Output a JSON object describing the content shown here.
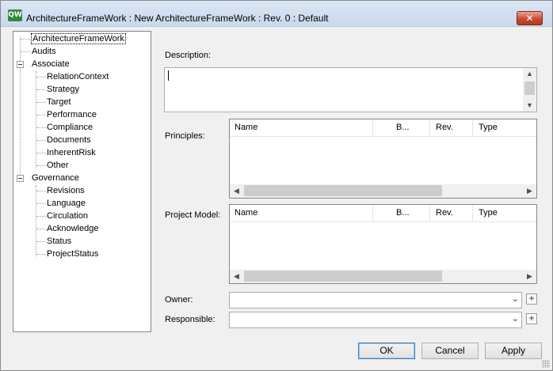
{
  "window": {
    "app_icon": "QW",
    "title": "ArchitectureFrameWork : New ArchitectureFrameWork : Rev. 0  : Default",
    "close_glyph": "✕"
  },
  "tree": {
    "items": [
      {
        "label": "ArchitectureFrameWork",
        "selected": true
      },
      {
        "label": "Audits"
      },
      {
        "label": "Associate",
        "expanded": true
      },
      {
        "label": "RelationContext"
      },
      {
        "label": "Strategy"
      },
      {
        "label": "Target"
      },
      {
        "label": "Performance"
      },
      {
        "label": "Compliance"
      },
      {
        "label": "Documents"
      },
      {
        "label": "InherentRisk"
      },
      {
        "label": "Other"
      },
      {
        "label": "Governance",
        "expanded": true
      },
      {
        "label": "Revisions"
      },
      {
        "label": "Language"
      },
      {
        "label": "Circulation"
      },
      {
        "label": "Acknowledge"
      },
      {
        "label": "Status"
      },
      {
        "label": "ProjectStatus"
      }
    ]
  },
  "form": {
    "description_label": "Description:",
    "description_value": "",
    "principles_label": "Principles:",
    "project_model_label": "Project Model:",
    "owner_label": "Owner:",
    "responsible_label": "Responsible:"
  },
  "grid_columns": [
    "Name",
    "B...",
    "Rev.",
    "Type"
  ],
  "buttons": {
    "ok": "OK",
    "cancel": "Cancel",
    "apply": "Apply",
    "add": "+"
  },
  "icons": {
    "collapse": "minus-box-icon",
    "scroll_up": "▲",
    "scroll_down": "▼",
    "scroll_left": "◀",
    "scroll_right": "▶",
    "dropdown": "⌄"
  }
}
